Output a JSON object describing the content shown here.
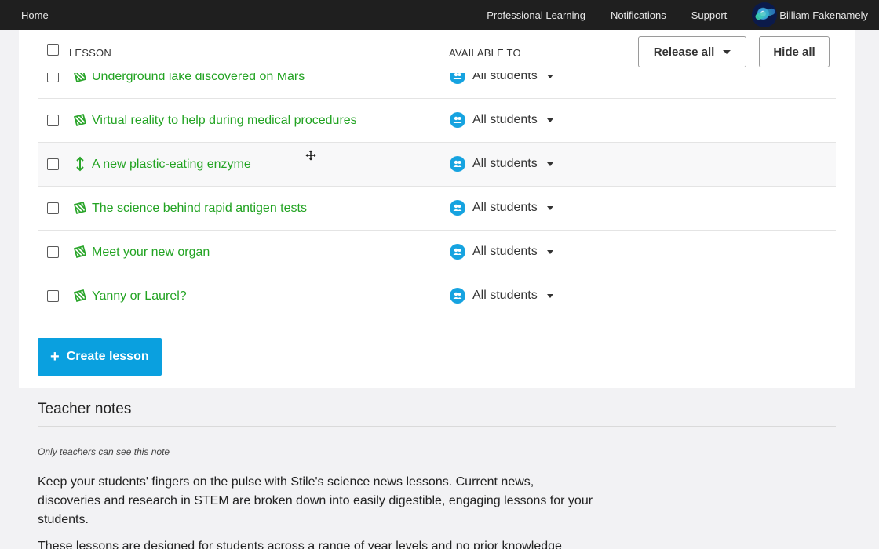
{
  "nav": {
    "home": "Home",
    "links": [
      "Professional Learning",
      "Notifications",
      "Support"
    ],
    "user_name": "Billiam Fakenamely"
  },
  "table": {
    "header": {
      "lesson": "LESSON",
      "available_to": "AVAILABLE TO",
      "release_all": "Release all",
      "hide_all": "Hide all"
    },
    "rows": [
      {
        "title": "Underground lake discovered on Mars",
        "available": "All students"
      },
      {
        "title": "Virtual reality to help during medical procedures",
        "available": "All students"
      },
      {
        "title": "A new plastic-eating enzyme",
        "available": "All students"
      },
      {
        "title": "The science behind rapid antigen tests",
        "available": "All students"
      },
      {
        "title": "Meet your new organ",
        "available": "All students"
      },
      {
        "title": "Yanny or Laurel?",
        "available": "All students"
      }
    ]
  },
  "create_lesson": "Create lesson",
  "teacher_notes": {
    "heading": "Teacher notes",
    "visibility": "Only teachers can see this note",
    "paragraph1": "Keep your students' fingers on the pulse with Stile's science news lessons. Current news, discoveries and research in STEM are broken down into easily digestible, engaging lessons for your students.",
    "paragraph2": "These lessons are designed for students across a range of year levels and no prior knowledge"
  },
  "colors": {
    "lesson_green": "#22a322",
    "primary_blue": "#0aa0df",
    "topbar": "#1f1f1f"
  }
}
